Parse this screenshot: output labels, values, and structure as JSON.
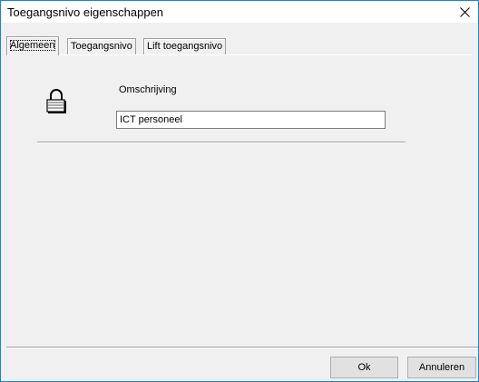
{
  "window": {
    "title": "Toegangsnivo eigenschappen",
    "close_icon": "close-icon"
  },
  "tabs": [
    {
      "label": "Algemeen",
      "active": true
    },
    {
      "label": "Toegangsnivo",
      "active": false
    },
    {
      "label": "Lift toegangsnivo",
      "active": false
    }
  ],
  "general": {
    "icon": "padlock-icon",
    "description_label": "Omschrijving",
    "description_value": "ICT personeel"
  },
  "buttons": {
    "ok_label": "Ok",
    "cancel_label": "Annuleren"
  },
  "colors": {
    "window_border": "#1883d7",
    "dialog_background": "#f0f0f0",
    "button_background": "#e1e1e1"
  }
}
